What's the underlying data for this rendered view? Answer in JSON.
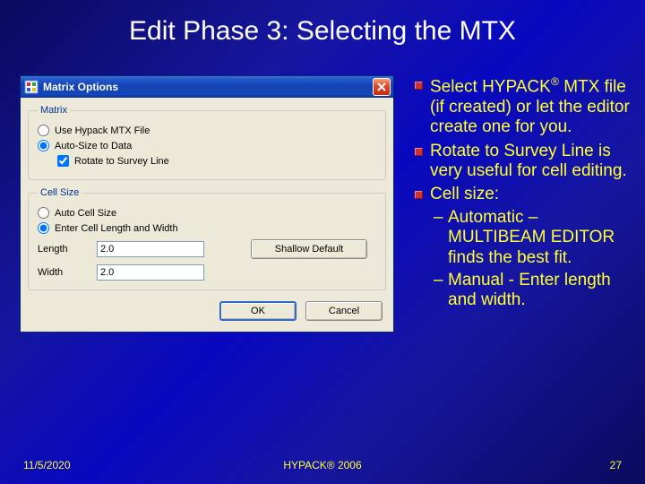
{
  "slide": {
    "title": "Edit Phase 3: Selecting the MTX"
  },
  "dialog": {
    "title": "Matrix Options",
    "groups": {
      "matrix_legend": "Matrix",
      "cellsize_legend": "Cell Size"
    },
    "matrix": {
      "use_file": "Use Hypack MTX File",
      "auto_size": "Auto-Size to Data",
      "rotate": "Rotate to Survey Line"
    },
    "cell": {
      "auto": "Auto Cell Size",
      "enter": "Enter Cell Length and Width",
      "length_label": "Length",
      "width_label": "Width",
      "length_value": "2.0",
      "width_value": "2.0",
      "shallow_btn": "Shallow Default"
    },
    "buttons": {
      "ok": "OK",
      "cancel": "Cancel"
    }
  },
  "bullets": {
    "b1a": "Select HYPACK",
    "b1sup": "®",
    "b1b": " MTX file (if created) or let the editor create one for you.",
    "b2": "Rotate to Survey Line is very useful for cell editing.",
    "b3": "Cell size:",
    "b3a": "Automatic – MULTIBEAM EDITOR finds the best fit.",
    "b3b": "Manual - Enter length and width."
  },
  "footer": {
    "date": "11/5/2020",
    "center": "HYPACK® 2006",
    "page": "27"
  }
}
